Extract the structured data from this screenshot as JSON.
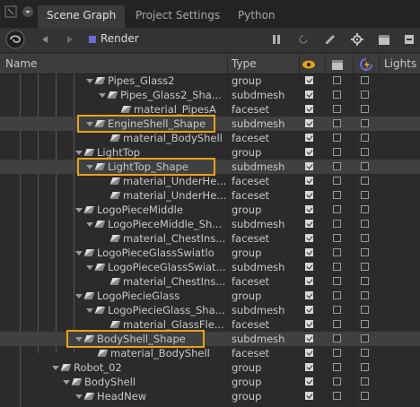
{
  "tabs": [
    {
      "label": "Scene Graph",
      "active": true
    },
    {
      "label": "Project Settings",
      "active": false
    },
    {
      "label": "Python",
      "active": false
    }
  ],
  "toolbar": {
    "render_label": "Render"
  },
  "columns": {
    "name": "Name",
    "type": "Type",
    "lights": "Lights"
  },
  "rows": [
    {
      "label": "Pipes_Glass2",
      "type": "group",
      "c1": true
    },
    {
      "label": "Pipes_Glass2_Sha...",
      "type": "subdmesh",
      "c1": true
    },
    {
      "label": "material_PipesA",
      "type": "faceset",
      "c1": true
    },
    {
      "label": "EngineShell_Shape",
      "type": "subdmesh",
      "c1": true
    },
    {
      "label": "material_BodyShell",
      "type": "faceset",
      "c1": true
    },
    {
      "label": "LightTop",
      "type": "group",
      "c1": true
    },
    {
      "label": "LightTop_Shape",
      "type": "subdmesh",
      "c1": true
    },
    {
      "label": "material_UnderHe...",
      "type": "faceset",
      "c1": true
    },
    {
      "label": "material_UnderHe...",
      "type": "faceset",
      "c1": true
    },
    {
      "label": "LogoPieceMiddle",
      "type": "group",
      "c1": true
    },
    {
      "label": "LogoPieceMiddle_Sh...",
      "type": "subdmesh",
      "c1": true
    },
    {
      "label": "material_ChestIns...",
      "type": "faceset",
      "c1": true
    },
    {
      "label": "LogoPieceGlassSwiatlo",
      "type": "group",
      "c1": true
    },
    {
      "label": "LogoPieceGlassSwiat...",
      "type": "subdmesh",
      "c1": true
    },
    {
      "label": "material_ChestIns...",
      "type": "faceset",
      "c1": true
    },
    {
      "label": "LogoPiecieGlass",
      "type": "group",
      "c1": true
    },
    {
      "label": "LogoPiecieGlass_Sha...",
      "type": "subdmesh",
      "c1": true
    },
    {
      "label": "material_GlassFle...",
      "type": "faceset",
      "c1": true
    },
    {
      "label": "BodyShell_Shape",
      "type": "subdmesh",
      "c1": true
    },
    {
      "label": "material_BodyShell",
      "type": "faceset",
      "c1": true
    },
    {
      "label": "Robot_02",
      "type": "group",
      "c1": true
    },
    {
      "label": "BodyShell",
      "type": "group",
      "c1": true
    },
    {
      "label": "HeadNew",
      "type": "group",
      "c1": true
    }
  ],
  "colors": {
    "highlight": "#e6a21a",
    "accent_square": "#6b6bd6"
  }
}
